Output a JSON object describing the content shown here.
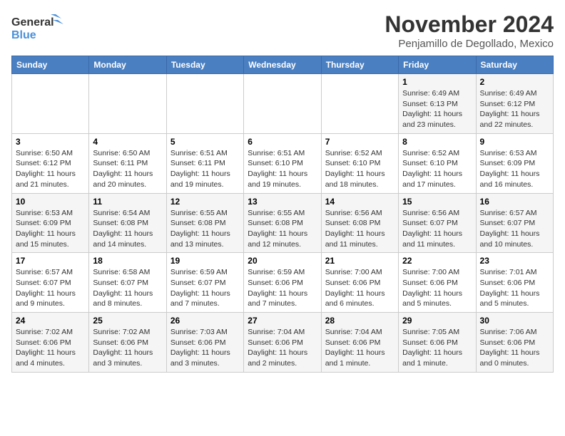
{
  "header": {
    "logo_line1": "General",
    "logo_line2": "Blue",
    "title": "November 2024",
    "subtitle": "Penjamillo de Degollado, Mexico"
  },
  "calendar": {
    "days_of_week": [
      "Sunday",
      "Monday",
      "Tuesday",
      "Wednesday",
      "Thursday",
      "Friday",
      "Saturday"
    ],
    "weeks": [
      [
        {
          "day": "",
          "info": ""
        },
        {
          "day": "",
          "info": ""
        },
        {
          "day": "",
          "info": ""
        },
        {
          "day": "",
          "info": ""
        },
        {
          "day": "",
          "info": ""
        },
        {
          "day": "1",
          "info": "Sunrise: 6:49 AM\nSunset: 6:13 PM\nDaylight: 11 hours\nand 23 minutes."
        },
        {
          "day": "2",
          "info": "Sunrise: 6:49 AM\nSunset: 6:12 PM\nDaylight: 11 hours\nand 22 minutes."
        }
      ],
      [
        {
          "day": "3",
          "info": "Sunrise: 6:50 AM\nSunset: 6:12 PM\nDaylight: 11 hours\nand 21 minutes."
        },
        {
          "day": "4",
          "info": "Sunrise: 6:50 AM\nSunset: 6:11 PM\nDaylight: 11 hours\nand 20 minutes."
        },
        {
          "day": "5",
          "info": "Sunrise: 6:51 AM\nSunset: 6:11 PM\nDaylight: 11 hours\nand 19 minutes."
        },
        {
          "day": "6",
          "info": "Sunrise: 6:51 AM\nSunset: 6:10 PM\nDaylight: 11 hours\nand 19 minutes."
        },
        {
          "day": "7",
          "info": "Sunrise: 6:52 AM\nSunset: 6:10 PM\nDaylight: 11 hours\nand 18 minutes."
        },
        {
          "day": "8",
          "info": "Sunrise: 6:52 AM\nSunset: 6:10 PM\nDaylight: 11 hours\nand 17 minutes."
        },
        {
          "day": "9",
          "info": "Sunrise: 6:53 AM\nSunset: 6:09 PM\nDaylight: 11 hours\nand 16 minutes."
        }
      ],
      [
        {
          "day": "10",
          "info": "Sunrise: 6:53 AM\nSunset: 6:09 PM\nDaylight: 11 hours\nand 15 minutes."
        },
        {
          "day": "11",
          "info": "Sunrise: 6:54 AM\nSunset: 6:08 PM\nDaylight: 11 hours\nand 14 minutes."
        },
        {
          "day": "12",
          "info": "Sunrise: 6:55 AM\nSunset: 6:08 PM\nDaylight: 11 hours\nand 13 minutes."
        },
        {
          "day": "13",
          "info": "Sunrise: 6:55 AM\nSunset: 6:08 PM\nDaylight: 11 hours\nand 12 minutes."
        },
        {
          "day": "14",
          "info": "Sunrise: 6:56 AM\nSunset: 6:08 PM\nDaylight: 11 hours\nand 11 minutes."
        },
        {
          "day": "15",
          "info": "Sunrise: 6:56 AM\nSunset: 6:07 PM\nDaylight: 11 hours\nand 11 minutes."
        },
        {
          "day": "16",
          "info": "Sunrise: 6:57 AM\nSunset: 6:07 PM\nDaylight: 11 hours\nand 10 minutes."
        }
      ],
      [
        {
          "day": "17",
          "info": "Sunrise: 6:57 AM\nSunset: 6:07 PM\nDaylight: 11 hours\nand 9 minutes."
        },
        {
          "day": "18",
          "info": "Sunrise: 6:58 AM\nSunset: 6:07 PM\nDaylight: 11 hours\nand 8 minutes."
        },
        {
          "day": "19",
          "info": "Sunrise: 6:59 AM\nSunset: 6:07 PM\nDaylight: 11 hours\nand 7 minutes."
        },
        {
          "day": "20",
          "info": "Sunrise: 6:59 AM\nSunset: 6:06 PM\nDaylight: 11 hours\nand 7 minutes."
        },
        {
          "day": "21",
          "info": "Sunrise: 7:00 AM\nSunset: 6:06 PM\nDaylight: 11 hours\nand 6 minutes."
        },
        {
          "day": "22",
          "info": "Sunrise: 7:00 AM\nSunset: 6:06 PM\nDaylight: 11 hours\nand 5 minutes."
        },
        {
          "day": "23",
          "info": "Sunrise: 7:01 AM\nSunset: 6:06 PM\nDaylight: 11 hours\nand 5 minutes."
        }
      ],
      [
        {
          "day": "24",
          "info": "Sunrise: 7:02 AM\nSunset: 6:06 PM\nDaylight: 11 hours\nand 4 minutes."
        },
        {
          "day": "25",
          "info": "Sunrise: 7:02 AM\nSunset: 6:06 PM\nDaylight: 11 hours\nand 3 minutes."
        },
        {
          "day": "26",
          "info": "Sunrise: 7:03 AM\nSunset: 6:06 PM\nDaylight: 11 hours\nand 3 minutes."
        },
        {
          "day": "27",
          "info": "Sunrise: 7:04 AM\nSunset: 6:06 PM\nDaylight: 11 hours\nand 2 minutes."
        },
        {
          "day": "28",
          "info": "Sunrise: 7:04 AM\nSunset: 6:06 PM\nDaylight: 11 hours\nand 1 minute."
        },
        {
          "day": "29",
          "info": "Sunrise: 7:05 AM\nSunset: 6:06 PM\nDaylight: 11 hours\nand 1 minute."
        },
        {
          "day": "30",
          "info": "Sunrise: 7:06 AM\nSunset: 6:06 PM\nDaylight: 11 hours\nand 0 minutes."
        }
      ]
    ]
  }
}
